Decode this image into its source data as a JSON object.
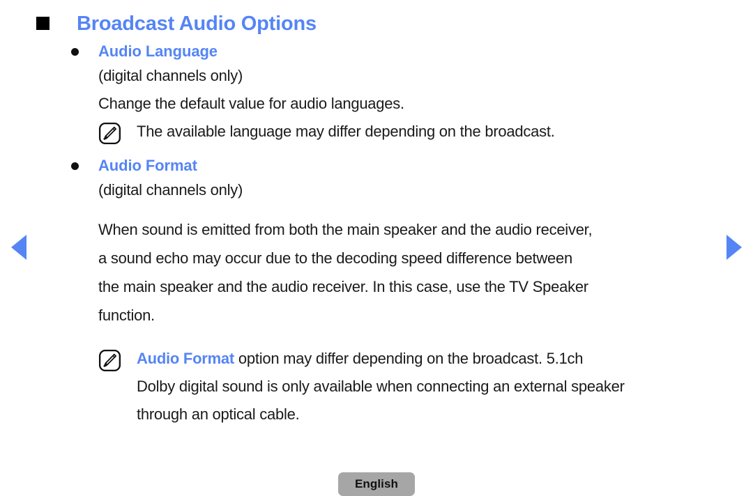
{
  "heading": {
    "title": "Broadcast Audio Options",
    "marker": "square-marker"
  },
  "accent_color": "#5585f5",
  "text_color": "#1a1a1a",
  "sections": [
    {
      "id": "audio-language",
      "label": "Audio Language",
      "subtitle": "(digital channels only)",
      "body": "Change the default value for audio languages.",
      "note": {
        "icon": "note-pencil-icon",
        "lines": [
          "The available language may differ depending on the broadcast."
        ]
      }
    },
    {
      "id": "audio-format",
      "label": "Audio Format",
      "subtitle": "(digital channels only)",
      "body_lines": [
        "When sound is emitted from both the main speaker and the audio receiver,",
        "a sound echo may occur due to the decoding speed difference between",
        "the main speaker and the audio receiver. In this case, use the TV Speaker",
        "function."
      ],
      "note": {
        "icon": "note-pencil-icon",
        "keyword": "Audio Format",
        "line1_rest": " option may differ depending on the broadcast. 5.1ch",
        "lines": [
          "Dolby digital sound is only available when connecting an external speaker",
          "through an optical cable."
        ]
      }
    }
  ],
  "navigation": {
    "prev_label": "previous-page",
    "next_label": "next-page"
  },
  "footer": {
    "language": "English"
  }
}
